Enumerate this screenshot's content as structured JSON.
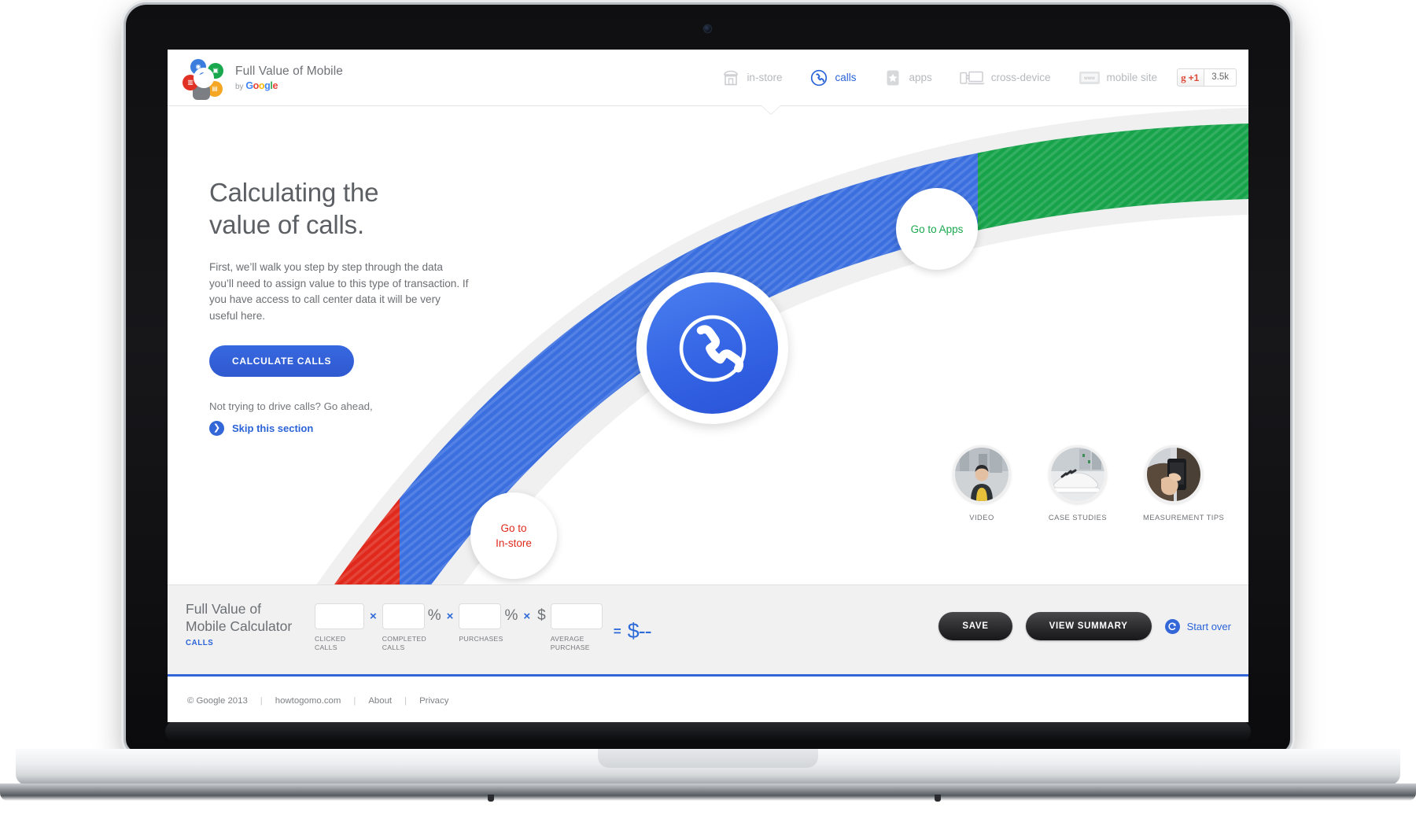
{
  "brand": {
    "title": "Full Value of Mobile",
    "by": "by",
    "google": "Google",
    "logo_icon": "full-value-of-mobile-logo"
  },
  "nav": {
    "items": [
      {
        "label": "in-store",
        "icon": "storefront-icon",
        "active": false
      },
      {
        "label": "calls",
        "icon": "phone-circle-icon",
        "active": true
      },
      {
        "label": "apps",
        "icon": "star-app-icon",
        "active": false
      },
      {
        "label": "cross-device",
        "icon": "devices-icon",
        "active": false
      },
      {
        "label": "mobile site",
        "icon": "www-tablet-icon",
        "active": false
      }
    ],
    "plusone": {
      "g_letter": "g",
      "label": "+1",
      "count": "3.5k"
    }
  },
  "hero": {
    "headline_line1": "Calculating the",
    "headline_line2": "value of calls.",
    "body": "First, we’ll walk you step by step through the data you’ll need to assign value to this type of transaction. If you have access to call center data it will be very useful here.",
    "cta_label": "CALCULATE CALLS",
    "skip_note": "Not trying to drive calls? Go ahead,",
    "skip_link": "Skip this section",
    "skip_icon": "chevron-right-circle-icon",
    "center_icon": "phone-handset-icon"
  },
  "ribbon": {
    "go_apps_label": "Go to Apps",
    "go_instore_line1": "Go to",
    "go_instore_line2": "In-store",
    "color_red": "#e0291c",
    "color_blue": "#3b6fe0",
    "color_green": "#16a34a"
  },
  "thumbs": [
    {
      "label": "VIDEO",
      "icon": "video-thumbnail-woman"
    },
    {
      "label": "CASE STUDIES",
      "icon": "case-studies-thumbnail-shoe"
    },
    {
      "label": "MEASUREMENT TIPS",
      "icon": "measurement-tips-thumbnail-phone"
    }
  ],
  "calculator": {
    "title_line1": "Full Value of",
    "title_line2": "Mobile Calculator",
    "mode": "CALLS",
    "fields": [
      {
        "caption": "CLICKED CALLS",
        "value": "",
        "suffix": ""
      },
      {
        "caption": "COMPLETED CALLS",
        "value": "",
        "suffix": "%"
      },
      {
        "caption": "PURCHASES",
        "value": "",
        "suffix": "%"
      },
      {
        "caption": "AVERAGE PURCHASE",
        "value": "",
        "prefix": "$"
      }
    ],
    "operators": [
      "×",
      "×",
      "×"
    ],
    "equals": "=",
    "result": "$--",
    "save_label": "SAVE",
    "view_summary_label": "VIEW SUMMARY",
    "start_over_label": "Start over",
    "start_over_icon": "reset-circle-icon"
  },
  "footer": {
    "copyright": "© Google 2013",
    "separator": "|",
    "links": [
      "howtogomo.com",
      "About",
      "Privacy"
    ]
  }
}
